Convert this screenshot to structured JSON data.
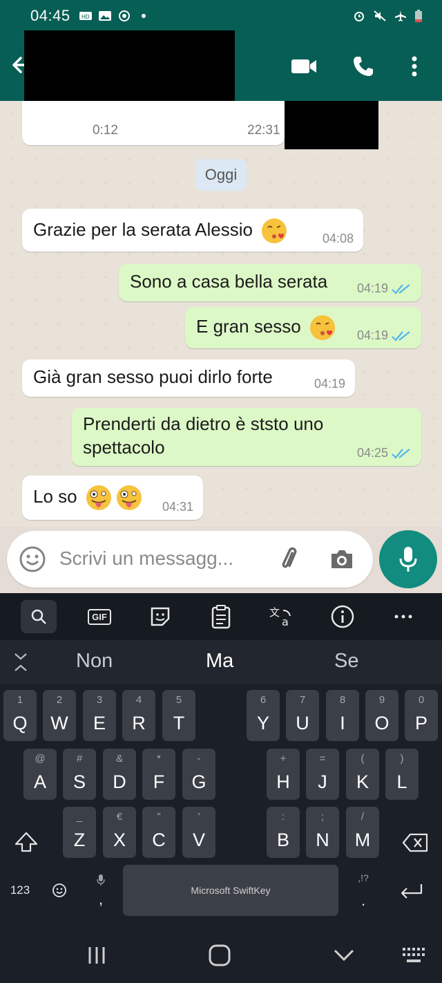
{
  "status_bar": {
    "time": "04:45",
    "left_icons": [
      "hd-icon",
      "gallery-icon",
      "sync-icon",
      "dot"
    ],
    "right_icons": [
      "alarm-icon",
      "mute-icon",
      "airplane-icon",
      "battery-icon"
    ]
  },
  "header": {
    "colors": {
      "header": "#075e54",
      "accent": "#128c7e"
    }
  },
  "chat": {
    "audio_message": {
      "duration": "0:12",
      "time": "22:31"
    },
    "date_separator": "Oggi",
    "messages": [
      {
        "direction": "in",
        "text": "Grazie per la serata Alessio",
        "emoji": "kissing-heart",
        "time": "04:08"
      },
      {
        "direction": "out",
        "text": "Sono a casa bella serata",
        "time": "04:19",
        "status": "read"
      },
      {
        "direction": "out",
        "text": "E gran sesso",
        "emoji": "kissing-heart",
        "time": "04:19",
        "status": "read"
      },
      {
        "direction": "in",
        "text": "Già gran sesso puoi dirlo forte",
        "time": "04:19"
      },
      {
        "direction": "out",
        "text": "Prenderti da dietro è ststo uno spettacolo",
        "line1": "Prenderti da dietro è ststo uno",
        "line2": "spettacolo",
        "time": "04:25",
        "status": "read"
      },
      {
        "direction": "in",
        "text": "Lo so",
        "emoji": "winking-tongue x2",
        "time": "04:31"
      }
    ]
  },
  "composer": {
    "placeholder": "Scrivi un messagg..."
  },
  "keyboard": {
    "toolbar": [
      "search",
      "GIF",
      "sticker",
      "clipboard",
      "translate",
      "info",
      "more"
    ],
    "gif_label": "GIF",
    "suggestions": [
      "Non",
      "Ma",
      "Se"
    ],
    "row1": [
      {
        "hint": "1",
        "key": "Q"
      },
      {
        "hint": "2",
        "key": "W"
      },
      {
        "hint": "3",
        "key": "E"
      },
      {
        "hint": "4",
        "key": "R"
      },
      {
        "hint": "5",
        "key": "T"
      },
      {
        "hint": "6",
        "key": "Y"
      },
      {
        "hint": "7",
        "key": "U"
      },
      {
        "hint": "8",
        "key": "I"
      },
      {
        "hint": "9",
        "key": "O"
      },
      {
        "hint": "0",
        "key": "P"
      }
    ],
    "row2": [
      {
        "hint": "@",
        "key": "A"
      },
      {
        "hint": "#",
        "key": "S"
      },
      {
        "hint": "&",
        "key": "D"
      },
      {
        "hint": "*",
        "key": "F"
      },
      {
        "hint": "-",
        "key": "G"
      },
      {
        "hint": "+",
        "key": "H"
      },
      {
        "hint": "=",
        "key": "J"
      },
      {
        "hint": "(",
        "key": "K"
      },
      {
        "hint": ")",
        "key": "L"
      }
    ],
    "row3": [
      {
        "hint": "_",
        "key": "Z"
      },
      {
        "hint": "€",
        "key": "X"
      },
      {
        "hint": "\"",
        "key": "C"
      },
      {
        "hint": "'",
        "key": "V"
      },
      {
        "hint": ":",
        "key": "B"
      },
      {
        "hint": ";",
        "key": "N"
      },
      {
        "hint": "/",
        "key": "M"
      }
    ],
    "numbers_label": "123",
    "space_label": "Microsoft SwiftKey",
    "comma": ",",
    "period": ".",
    "punct_hint": ",!?"
  }
}
